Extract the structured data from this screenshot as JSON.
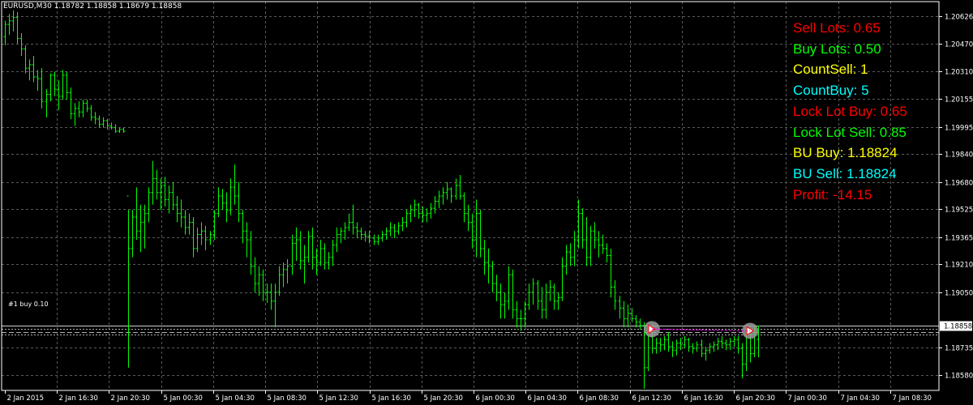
{
  "symbol_header": "EURUSD,M30  1.18782 1.18858 1.18679 1.18858",
  "level_tag": "#1 buy 0.10",
  "info_panel": [
    {
      "text": "Sell Lots: 0.65",
      "color": "#ff0000"
    },
    {
      "text": "Buy Lots: 0.50",
      "color": "#00ff00"
    },
    {
      "text": "CountSell: 1",
      "color": "#ffff00"
    },
    {
      "text": "CountBuy: 5",
      "color": "#00ffff"
    },
    {
      "text": "Lock Lot Buy: 0.65",
      "color": "#ff0000"
    },
    {
      "text": "Lock Lot Sell: 0.85",
      "color": "#00ff00"
    },
    {
      "text": "BU Buy: 1.18824",
      "color": "#ffff00"
    },
    {
      "text": "BU Sell: 1.18824",
      "color": "#00ffff"
    },
    {
      "text": "Profit: -14.15",
      "color": "#ff0000"
    }
  ],
  "colors": {
    "background": "#000000",
    "bars": "#00ff00",
    "grid": "#5a5a5a",
    "axis": "#ffffff",
    "level_line": "#b0b0b0",
    "bid_label_bg": "#ffffff",
    "bid_label_text": "#000000"
  },
  "chart_data": {
    "type": "ohlc-bars",
    "symbol": "EURUSD",
    "timeframe": "M30",
    "header": {
      "open": 1.18782,
      "high": 1.18858,
      "low": 1.18679,
      "close": 1.18858
    },
    "current_price": 1.18858,
    "ylim": [
      1.1849,
      1.2071
    ],
    "y_ticks": [
      {
        "value": 1.20626,
        "label": "1.20626"
      },
      {
        "value": 1.2047,
        "label": "1.20470"
      },
      {
        "value": 1.2031,
        "label": "1.20310"
      },
      {
        "value": 1.20155,
        "label": "1.20155"
      },
      {
        "value": 1.19995,
        "label": "1.19995"
      },
      {
        "value": 1.1984,
        "label": "1.19840"
      },
      {
        "value": 1.1968,
        "label": "1.19680"
      },
      {
        "value": 1.19525,
        "label": "1.19525"
      },
      {
        "value": 1.19365,
        "label": "1.19365"
      },
      {
        "value": 1.1921,
        "label": "1.19210"
      },
      {
        "value": 1.1905,
        "label": "1.19050"
      },
      {
        "value": 1.18735,
        "label": "1.18735"
      },
      {
        "value": 1.1858,
        "label": "1.18580"
      }
    ],
    "x_ticks": [
      "2 Jan 2015",
      "2 Jan 16:30",
      "2 Jan 20:30",
      "5 Jan 00:30",
      "5 Jan 04:30",
      "5 Jan 08:30",
      "5 Jan 12:30",
      "5 Jan 16:30",
      "5 Jan 20:30",
      "6 Jan 00:30",
      "6 Jan 04:30",
      "6 Jan 08:30",
      "6 Jan 12:30",
      "6 Jan 16:30",
      "6 Jan 20:30",
      "7 Jan 00:30",
      "7 Jan 04:30",
      "7 Jan 08:30"
    ],
    "levels": [
      1.18824,
      1.1884,
      1.1881
    ],
    "trade_markers": [
      {
        "bar": 158,
        "price": 1.1884
      },
      {
        "bar": 182,
        "price": 1.1883
      }
    ],
    "bars": [
      [
        1.2051,
        1.206,
        1.2046,
        1.2058
      ],
      [
        1.2058,
        1.2064,
        1.2052,
        1.206
      ],
      [
        1.206,
        1.2066,
        1.2054,
        1.2062
      ],
      [
        1.2062,
        1.2065,
        1.2047,
        1.205
      ],
      [
        1.205,
        1.2053,
        1.204,
        1.2044
      ],
      [
        1.2044,
        1.2046,
        1.203,
        1.2033
      ],
      [
        1.2033,
        1.2038,
        1.2026,
        1.2035
      ],
      [
        1.2035,
        1.204,
        1.2025,
        1.2028
      ],
      [
        1.2028,
        1.2032,
        1.202,
        1.2027
      ],
      [
        1.2027,
        1.2033,
        1.201,
        1.2014
      ],
      [
        1.2014,
        1.2021,
        1.2005,
        1.2018
      ],
      [
        1.2018,
        1.203,
        1.2014,
        1.2029
      ],
      [
        1.2029,
        1.2031,
        1.2017,
        1.2021
      ],
      [
        1.2021,
        1.2026,
        1.2009,
        1.2017
      ],
      [
        1.2017,
        1.2032,
        1.2015,
        1.2029
      ],
      [
        1.2029,
        1.2031,
        1.2015,
        1.2019
      ],
      [
        1.2019,
        1.2022,
        1.2004,
        1.2007
      ],
      [
        1.2007,
        1.2013,
        1.2,
        1.201
      ],
      [
        1.201,
        1.2014,
        1.2005,
        1.2008
      ],
      [
        1.2008,
        1.2015,
        1.2005,
        1.2013
      ],
      [
        1.2013,
        1.2015,
        1.2008,
        1.201
      ],
      [
        1.201,
        1.2012,
        1.2003,
        1.2005
      ],
      [
        1.2005,
        1.2008,
        1.2001,
        1.2004
      ],
      [
        1.2004,
        1.2006,
        1.1999,
        1.2001
      ],
      [
        1.2001,
        1.2005,
        1.1999,
        1.2003
      ],
      [
        1.2003,
        1.2004,
        1.1998,
        1.2
      ],
      [
        1.2,
        1.2002,
        1.1998,
        1.1999
      ],
      [
        1.1999,
        1.2001,
        1.1996,
        1.1997
      ],
      [
        1.1997,
        1.1999,
        1.1996,
        1.1998
      ],
      [
        1.1998,
        1.1999,
        1.1996,
        1.1997
      ],
      [
        1.196,
        1.1952,
        1.1862,
        1.193
      ],
      [
        1.193,
        1.1952,
        1.1925,
        1.1948
      ],
      [
        1.1948,
        1.1965,
        1.1935,
        1.194
      ],
      [
        1.194,
        1.1955,
        1.1928,
        1.1945
      ],
      [
        1.1945,
        1.1955,
        1.193,
        1.195
      ],
      [
        1.195,
        1.1965,
        1.1945,
        1.1962
      ],
      [
        1.1962,
        1.198,
        1.1955,
        1.197
      ],
      [
        1.197,
        1.1975,
        1.1958,
        1.1962
      ],
      [
        1.1962,
        1.197,
        1.1952,
        1.1966
      ],
      [
        1.1966,
        1.1971,
        1.1954,
        1.1958
      ],
      [
        1.1958,
        1.1966,
        1.195,
        1.1962
      ],
      [
        1.1962,
        1.1968,
        1.1952,
        1.1955
      ],
      [
        1.1955,
        1.196,
        1.1945,
        1.195
      ],
      [
        1.195,
        1.1958,
        1.1942,
        1.1948
      ],
      [
        1.1948,
        1.1952,
        1.1938,
        1.1942
      ],
      [
        1.1942,
        1.195,
        1.1938,
        1.1945
      ],
      [
        1.1945,
        1.1948,
        1.1925,
        1.193
      ],
      [
        1.193,
        1.1942,
        1.1928,
        1.1938
      ],
      [
        1.1938,
        1.1945,
        1.1932,
        1.194
      ],
      [
        1.194,
        1.1943,
        1.1929,
        1.1935
      ],
      [
        1.1935,
        1.194,
        1.1932,
        1.1938
      ],
      [
        1.1938,
        1.1952,
        1.1935,
        1.195
      ],
      [
        1.195,
        1.1965,
        1.1948,
        1.196
      ],
      [
        1.196,
        1.1964,
        1.1952,
        1.1956
      ],
      [
        1.1956,
        1.1962,
        1.1945,
        1.1952
      ],
      [
        1.1952,
        1.197,
        1.1949,
        1.1965
      ],
      [
        1.1965,
        1.1978,
        1.1955,
        1.196
      ],
      [
        1.196,
        1.1968,
        1.1945,
        1.195
      ],
      [
        1.195,
        1.1952,
        1.1933,
        1.194
      ],
      [
        1.194,
        1.1945,
        1.1925,
        1.1935
      ],
      [
        1.1935,
        1.194,
        1.1915,
        1.192
      ],
      [
        1.192,
        1.1925,
        1.1905,
        1.191
      ],
      [
        1.191,
        1.192,
        1.1903,
        1.1915
      ],
      [
        1.1915,
        1.1918,
        1.19,
        1.1905
      ],
      [
        1.1905,
        1.191,
        1.1899,
        1.1905
      ],
      [
        1.1905,
        1.191,
        1.1895,
        1.19
      ],
      [
        1.19,
        1.191,
        1.1885,
        1.1905
      ],
      [
        1.1905,
        1.192,
        1.1903,
        1.1915
      ],
      [
        1.1915,
        1.1922,
        1.1908,
        1.1918
      ],
      [
        1.1918,
        1.1924,
        1.191,
        1.192
      ],
      [
        1.192,
        1.1938,
        1.1915,
        1.1933
      ],
      [
        1.1933,
        1.1942,
        1.1923,
        1.1935
      ],
      [
        1.1935,
        1.194,
        1.1918,
        1.1923
      ],
      [
        1.1923,
        1.1932,
        1.191,
        1.1925
      ],
      [
        1.1925,
        1.194,
        1.1922,
        1.1937
      ],
      [
        1.1937,
        1.1942,
        1.1918,
        1.1925
      ],
      [
        1.1925,
        1.193,
        1.1915,
        1.1922
      ],
      [
        1.1922,
        1.1935,
        1.192,
        1.193
      ],
      [
        1.193,
        1.1933,
        1.1918,
        1.1922
      ],
      [
        1.1922,
        1.1928,
        1.1918,
        1.1925
      ],
      [
        1.1925,
        1.1935,
        1.192,
        1.1932
      ],
      [
        1.1932,
        1.1942,
        1.1928,
        1.1938
      ],
      [
        1.1938,
        1.1942,
        1.1933,
        1.194
      ],
      [
        1.194,
        1.1945,
        1.1935,
        1.1942
      ],
      [
        1.1942,
        1.195,
        1.194,
        1.1945
      ],
      [
        1.1945,
        1.1955,
        1.1938,
        1.1942
      ],
      [
        1.1942,
        1.1945,
        1.1936,
        1.194
      ],
      [
        1.194,
        1.1942,
        1.1935,
        1.1938
      ],
      [
        1.1938,
        1.194,
        1.1934,
        1.1937
      ],
      [
        1.1937,
        1.194,
        1.1933,
        1.1936
      ],
      [
        1.1936,
        1.1938,
        1.1932,
        1.1934
      ],
      [
        1.1934,
        1.1938,
        1.1932,
        1.1936
      ],
      [
        1.1936,
        1.194,
        1.1934,
        1.1938
      ],
      [
        1.1938,
        1.1942,
        1.1935,
        1.194
      ],
      [
        1.194,
        1.1945,
        1.1937,
        1.1942
      ],
      [
        1.1942,
        1.1944,
        1.1936,
        1.194
      ],
      [
        1.194,
        1.1945,
        1.1938,
        1.1943
      ],
      [
        1.1943,
        1.1948,
        1.194,
        1.1945
      ],
      [
        1.1945,
        1.1952,
        1.1942,
        1.195
      ],
      [
        1.195,
        1.1955,
        1.1945,
        1.1952
      ],
      [
        1.1952,
        1.1958,
        1.1948,
        1.1955
      ],
      [
        1.1955,
        1.1956,
        1.1947,
        1.195
      ],
      [
        1.195,
        1.1954,
        1.1945,
        1.1949
      ],
      [
        1.1949,
        1.1953,
        1.1945,
        1.195
      ],
      [
        1.195,
        1.1956,
        1.1947,
        1.1953
      ],
      [
        1.1953,
        1.196,
        1.195,
        1.1957
      ],
      [
        1.1957,
        1.1963,
        1.1953,
        1.196
      ],
      [
        1.196,
        1.1965,
        1.1955,
        1.1962
      ],
      [
        1.1962,
        1.1968,
        1.1958,
        1.1964
      ],
      [
        1.1964,
        1.1965,
        1.1956,
        1.196
      ],
      [
        1.196,
        1.197,
        1.1958,
        1.1966
      ],
      [
        1.1966,
        1.1972,
        1.1958,
        1.196
      ],
      [
        1.196,
        1.1962,
        1.1945,
        1.195
      ],
      [
        1.195,
        1.1955,
        1.194,
        1.1945
      ],
      [
        1.1945,
        1.195,
        1.193,
        1.1935
      ],
      [
        1.1935,
        1.1958,
        1.1925,
        1.195
      ],
      [
        1.195,
        1.1952,
        1.1925,
        1.193
      ],
      [
        1.193,
        1.1935,
        1.1915,
        1.1922
      ],
      [
        1.1922,
        1.193,
        1.191,
        1.192
      ],
      [
        1.192,
        1.1923,
        1.1905,
        1.191
      ],
      [
        1.191,
        1.1915,
        1.19,
        1.1905
      ],
      [
        1.1905,
        1.191,
        1.189,
        1.1898
      ],
      [
        1.1898,
        1.1905,
        1.189,
        1.19
      ],
      [
        1.19,
        1.192,
        1.1895,
        1.1915
      ],
      [
        1.1915,
        1.1918,
        1.189,
        1.1895
      ],
      [
        1.1895,
        1.19,
        1.1885,
        1.189
      ],
      [
        1.189,
        1.1895,
        1.1883,
        1.189
      ],
      [
        1.189,
        1.19,
        1.1885,
        1.1898
      ],
      [
        1.1898,
        1.191,
        1.1895,
        1.1905
      ],
      [
        1.1905,
        1.1913,
        1.1898,
        1.191
      ],
      [
        1.191,
        1.1912,
        1.1895,
        1.19
      ],
      [
        1.19,
        1.1908,
        1.189,
        1.1895
      ],
      [
        1.1895,
        1.191,
        1.189,
        1.1905
      ],
      [
        1.1905,
        1.1912,
        1.19,
        1.1908
      ],
      [
        1.1908,
        1.191,
        1.1895,
        1.19
      ],
      [
        1.19,
        1.1905,
        1.1895,
        1.1902
      ],
      [
        1.1902,
        1.1925,
        1.19,
        1.192
      ],
      [
        1.192,
        1.1932,
        1.1915,
        1.1928
      ],
      [
        1.1928,
        1.1933,
        1.192,
        1.1925
      ],
      [
        1.1925,
        1.194,
        1.192,
        1.1935
      ],
      [
        1.1935,
        1.1958,
        1.193,
        1.195
      ],
      [
        1.195,
        1.1953,
        1.193,
        1.1935
      ],
      [
        1.1935,
        1.1948,
        1.192,
        1.1925
      ],
      [
        1.1925,
        1.1943,
        1.192,
        1.194
      ],
      [
        1.194,
        1.1945,
        1.193,
        1.1935
      ],
      [
        1.1935,
        1.194,
        1.1925,
        1.1932
      ],
      [
        1.1932,
        1.1938,
        1.1927,
        1.193
      ],
      [
        1.193,
        1.1933,
        1.1922,
        1.1926
      ],
      [
        1.1926,
        1.193,
        1.1902,
        1.1908
      ],
      [
        1.1908,
        1.1912,
        1.1895,
        1.19
      ],
      [
        1.19,
        1.1903,
        1.189,
        1.1896
      ],
      [
        1.1896,
        1.19,
        1.1885,
        1.189
      ],
      [
        1.189,
        1.1898,
        1.1885,
        1.1893
      ],
      [
        1.1893,
        1.1896,
        1.1888,
        1.189
      ],
      [
        1.189,
        1.1892,
        1.1885,
        1.1888
      ],
      [
        1.1888,
        1.189,
        1.1884,
        1.1886
      ],
      [
        1.1886,
        1.1888,
        1.185,
        1.1862
      ],
      [
        1.1862,
        1.1882,
        1.186,
        1.188
      ],
      [
        1.188,
        1.1883,
        1.187,
        1.1873
      ],
      [
        1.1873,
        1.1879,
        1.187,
        1.1876
      ],
      [
        1.1876,
        1.1879,
        1.1871,
        1.1875
      ],
      [
        1.1875,
        1.188,
        1.1872,
        1.1878
      ],
      [
        1.1878,
        1.1882,
        1.1871,
        1.1874
      ],
      [
        1.1874,
        1.1877,
        1.1868,
        1.1872
      ],
      [
        1.1872,
        1.1878,
        1.1869,
        1.1876
      ],
      [
        1.1876,
        1.1879,
        1.1872,
        1.1875
      ],
      [
        1.1875,
        1.188,
        1.1873,
        1.1878
      ],
      [
        1.1878,
        1.1879,
        1.1871,
        1.1874
      ],
      [
        1.1874,
        1.1876,
        1.187,
        1.1873
      ],
      [
        1.1873,
        1.1877,
        1.1871,
        1.1875
      ],
      [
        1.1875,
        1.1878,
        1.1868,
        1.187
      ],
      [
        1.187,
        1.1874,
        1.1866,
        1.1872
      ],
      [
        1.1872,
        1.1876,
        1.187,
        1.1874
      ],
      [
        1.1874,
        1.1877,
        1.1871,
        1.1875
      ],
      [
        1.1875,
        1.1879,
        1.1872,
        1.1877
      ],
      [
        1.1877,
        1.188,
        1.1873,
        1.1876
      ],
      [
        1.1876,
        1.1878,
        1.1872,
        1.1875
      ],
      [
        1.1875,
        1.1879,
        1.1872,
        1.1877
      ],
      [
        1.1877,
        1.188,
        1.1874,
        1.1878
      ],
      [
        1.1878,
        1.188,
        1.187,
        1.1873
      ],
      [
        1.1873,
        1.1876,
        1.1856,
        1.1864
      ],
      [
        1.1864,
        1.1885,
        1.186,
        1.1882
      ],
      [
        1.1882,
        1.1884,
        1.1865,
        1.187
      ],
      [
        1.187,
        1.1886,
        1.1868,
        1.1884
      ],
      [
        1.18782,
        1.18858,
        1.18679,
        1.18858
      ]
    ]
  }
}
